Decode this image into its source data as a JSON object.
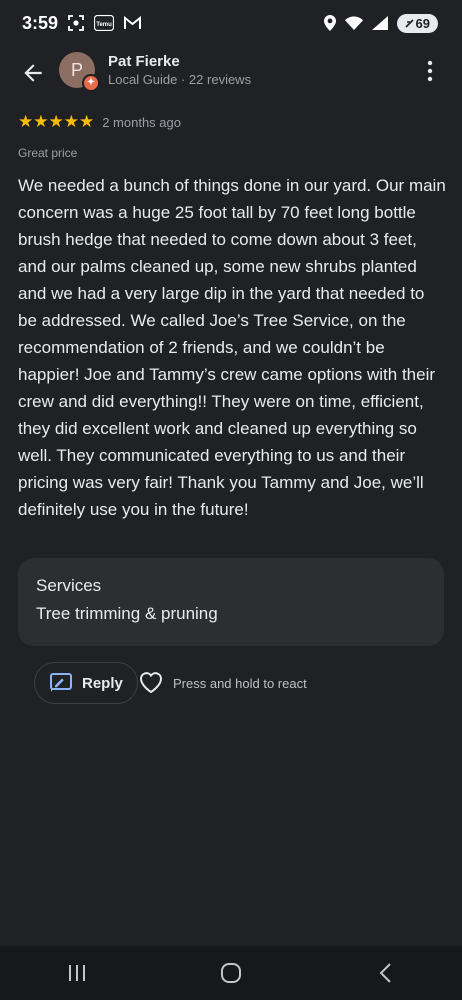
{
  "status_bar": {
    "time": "3:59",
    "notification_icons": [
      "screenshot-icon",
      "temu-icon",
      "gmail-icon"
    ],
    "temu_label": "Temu",
    "system_icons": [
      "location-icon",
      "wifi-icon",
      "signal-icon"
    ],
    "battery": "69"
  },
  "header": {
    "avatar_initial": "P",
    "reviewer_name": "Pat Fierke",
    "reviewer_meta": "Local Guide · 22 reviews"
  },
  "review": {
    "rating": 5,
    "stars": "★★★★★",
    "date": "2 months ago",
    "tag": "Great price",
    "body": "We needed a bunch of things done in our yard. Our main concern was a huge 25 foot tall by 70 feet long bottle brush hedge that needed to come down about 3 feet, and our palms cleaned up, some new shrubs planted and we had a very large dip in the yard that needed to be addressed. We called Joe’s Tree Service, on the recommendation of 2 friends, and we couldn’t be happier! Joe and Tammy’s crew came options with their crew and did everything!! They were on time, efficient, they did excellent work and cleaned up everything so well. They communicated everything to us and their pricing was very fair! Thank you Tammy and Joe, we’ll definitely use you in the future!"
  },
  "services": {
    "title": "Services",
    "value": "Tree trimming & pruning"
  },
  "actions": {
    "reply_label": "Reply",
    "react_hint": "Press and hold to react"
  },
  "colors": {
    "background": "#202124",
    "card": "#2d2e31",
    "star": "#fbbc04",
    "text": "#e8eaed",
    "secondary_text": "#9aa0a6",
    "guide_badge": "#ea6b4b"
  }
}
